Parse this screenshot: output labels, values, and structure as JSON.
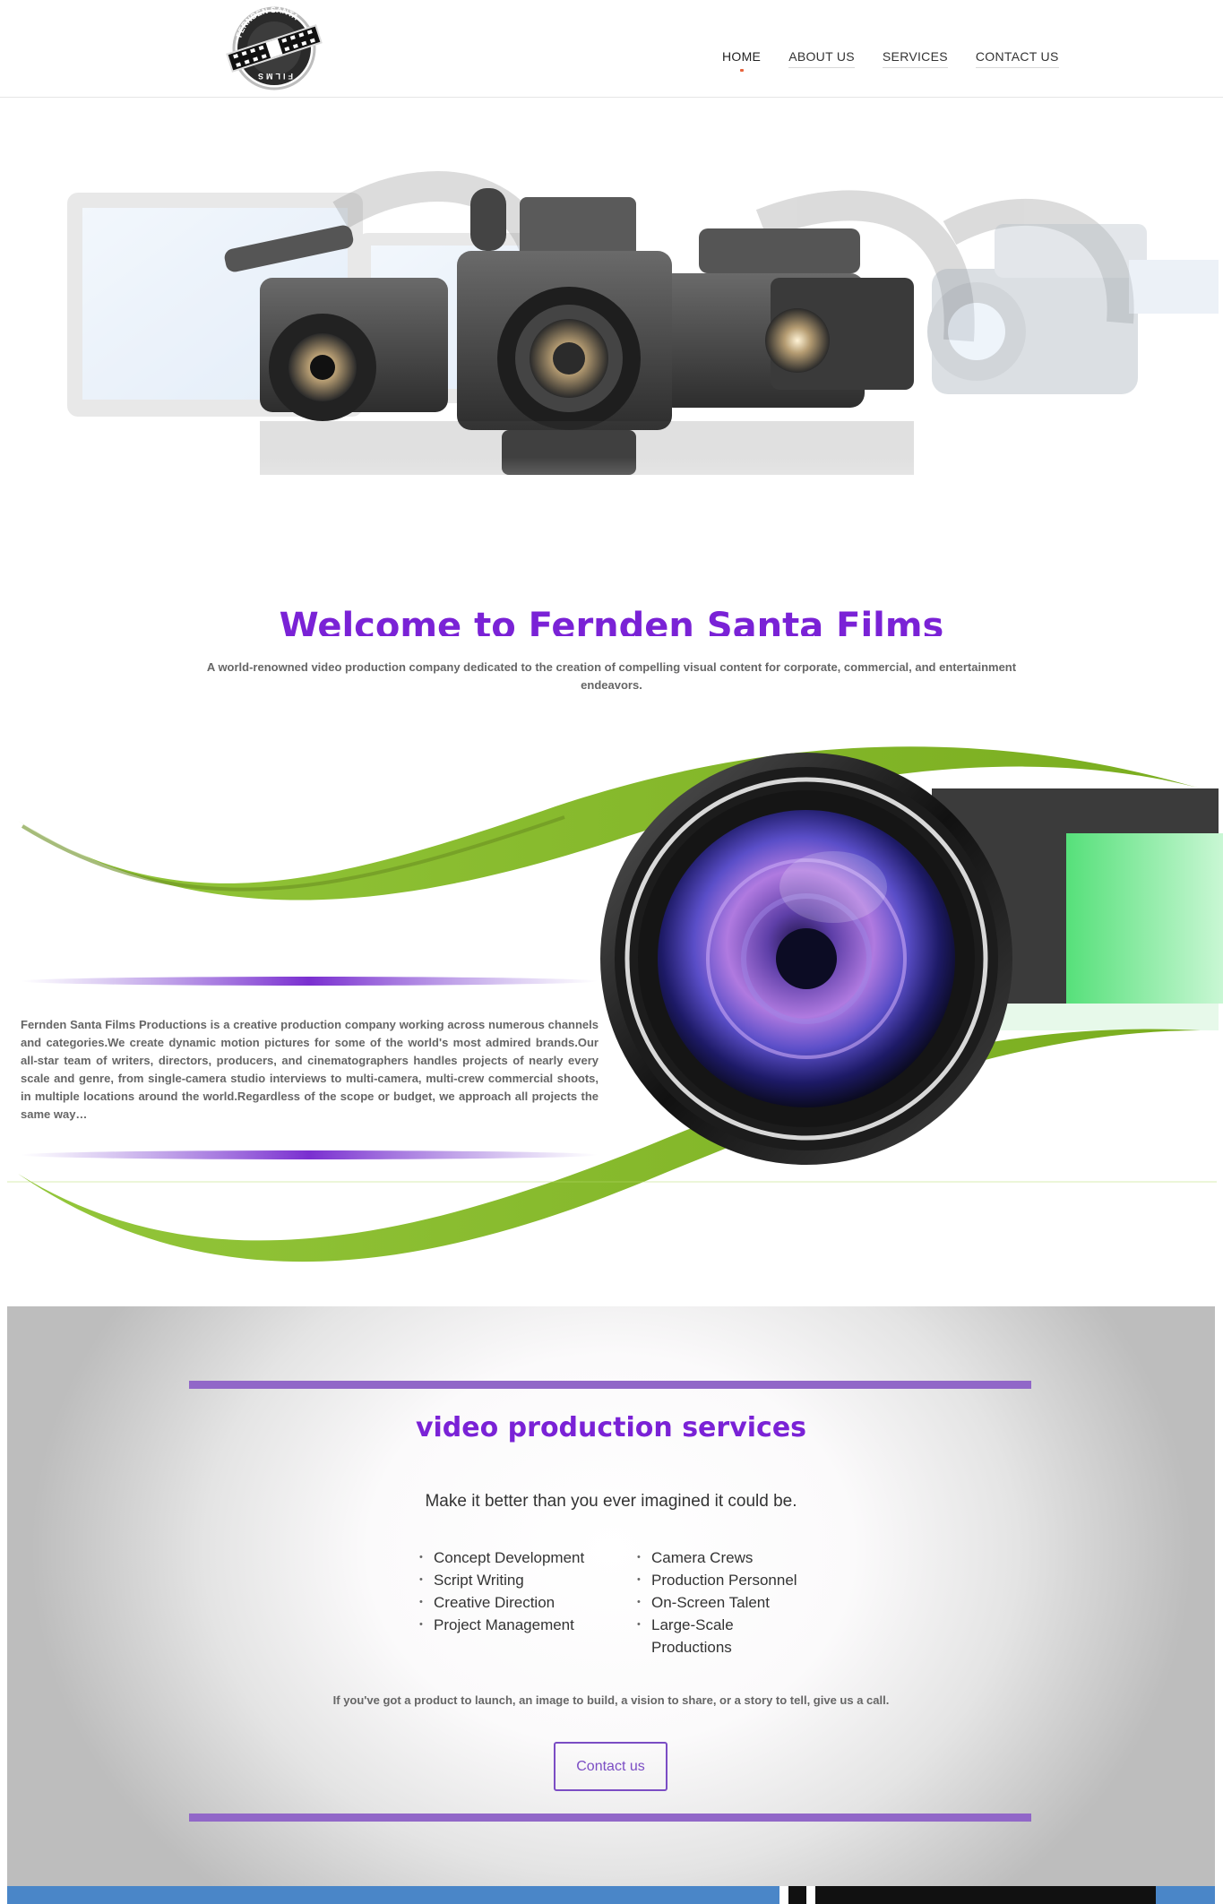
{
  "header": {
    "logo_text_top": "FERNDEN SANTA",
    "logo_text_bottom": "FILMS",
    "nav": [
      {
        "label": "HOME",
        "active": true
      },
      {
        "label": "ABOUT US",
        "active": false
      },
      {
        "label": "SERVICES",
        "active": false
      },
      {
        "label": "CONTACT US",
        "active": false
      }
    ]
  },
  "welcome": {
    "title": "Welcome to Fernden Santa Films",
    "tagline": "A world-renowned video production company dedicated to the creation of compelling visual content for corporate, commercial, and entertainment endeavors."
  },
  "about": {
    "body": "Fernden Santa Films Productions is a creative production company working across numerous channels and categories.We create dynamic motion pictures for some of the world's most admired brands.Our all-star team of writers, directors, producers, and cinematographers handles projects of nearly every scale and genre, from single-camera studio interviews to multi-camera, multi-crew commercial shoots, in multiple locations around the world.Regardless of the scope or budget, we approach all projects the same way…"
  },
  "services": {
    "title": "video production services",
    "subtitle": "Make it better than you ever imagined it could be.",
    "col1": [
      "Concept Development",
      "Script Writing",
      "Creative Direction",
      "Project Management"
    ],
    "col2": [
      "Camera Crews",
      "Production Personnel",
      "On-Screen Talent",
      "Large-Scale Productions"
    ],
    "call": "If you've got a product to launch, an image to build, a vision to share, or a story to tell, give us a call.",
    "button": "Contact us"
  },
  "colors": {
    "accent_purple": "#7a22d6",
    "bar_purple": "#9167c8",
    "swoosh_green": "#8fc12e",
    "footer_blue": "#4a86c8"
  }
}
